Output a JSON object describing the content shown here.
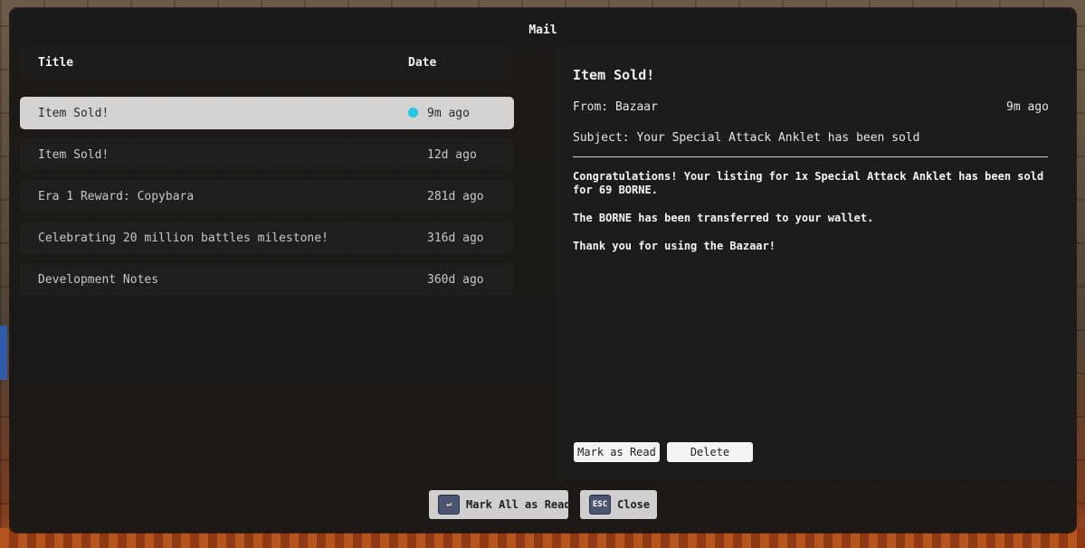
{
  "window": {
    "title": "Mail"
  },
  "list": {
    "header": {
      "title_col": "Title",
      "date_col": "Date"
    },
    "items": [
      {
        "title": "Item Sold!",
        "date": "9m ago",
        "unread": true,
        "selected": true
      },
      {
        "title": "Item Sold!",
        "date": "12d ago",
        "unread": false,
        "selected": false
      },
      {
        "title": "Era 1 Reward: Copybara",
        "date": "281d ago",
        "unread": false,
        "selected": false
      },
      {
        "title": "Celebrating 20 million battles milestone!",
        "date": "316d ago",
        "unread": false,
        "selected": false
      },
      {
        "title": "Development Notes",
        "date": "360d ago",
        "unread": false,
        "selected": false
      }
    ]
  },
  "detail": {
    "title": "Item Sold!",
    "from": "From: Bazaar",
    "date": "9m ago",
    "subject": "Subject: Your Special Attack Anklet has been sold",
    "body": [
      "Congratulations! Your listing for 1x Special Attack Anklet has been sold for 69 BORNE.",
      "The BORNE has been transferred to your wallet.",
      "Thank you for using the Bazaar!"
    ],
    "mark_read_label": "Mark as Read",
    "delete_label": "Delete"
  },
  "footer": {
    "mark_all_label": "Mark All as Read",
    "mark_all_key": "↵",
    "close_label": "Close",
    "close_key": "ESC"
  },
  "colors": {
    "unread_dot": "#22c8e5",
    "selected_row": "#d3d3d3",
    "panel_bg": "#181818"
  },
  "icons": {
    "mark_all_key": "enter-key-icon",
    "close_key": "escape-key-icon",
    "unread": "unread-dot-icon"
  }
}
